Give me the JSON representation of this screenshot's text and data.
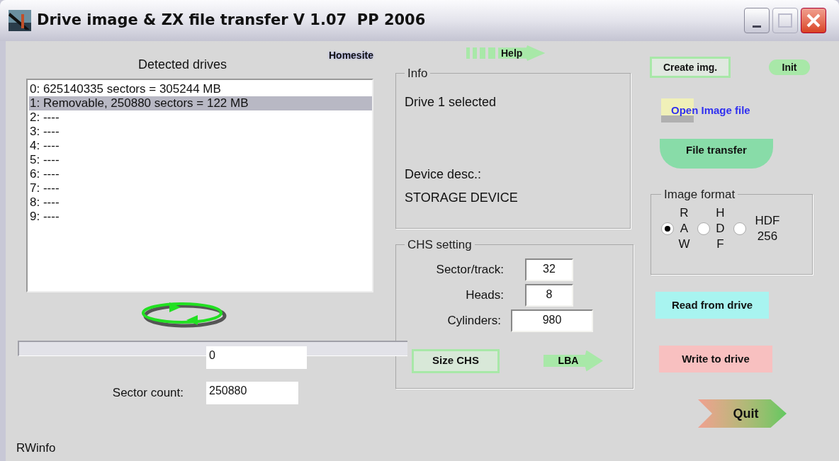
{
  "window": {
    "title": "Drive image & ZX file transfer V 1.07  PP 2006"
  },
  "homesite": "Homesite",
  "help": "Help",
  "drives": {
    "title": "Detected drives",
    "items": [
      {
        "label": "0: 625140335 sectors = 305244 MB",
        "selected": false
      },
      {
        "label": "1: Removable, 250880 sectors = 122 MB",
        "selected": true
      },
      {
        "label": "2: ----",
        "selected": false
      },
      {
        "label": "3: ----",
        "selected": false
      },
      {
        "label": "4: ----",
        "selected": false
      },
      {
        "label": "5: ----",
        "selected": false
      },
      {
        "label": "6: ----",
        "selected": false
      },
      {
        "label": "7: ----",
        "selected": false
      },
      {
        "label": "8: ----",
        "selected": false
      },
      {
        "label": "9: ----",
        "selected": false
      }
    ]
  },
  "progress": {
    "level": 0
  },
  "sectors_from_start": {
    "value": "0"
  },
  "sector_count": {
    "label": "Sector count:",
    "value": "250880"
  },
  "status": "RWinfo",
  "info": {
    "title": "Info",
    "message": "Drive 1 selected",
    "device_label": "Device desc.:",
    "device": "STORAGE DEVICE"
  },
  "chs": {
    "title": "CHS setting",
    "fields": [
      {
        "label": "Sector/track:",
        "value": "32"
      },
      {
        "label": "Heads:",
        "value": "8"
      },
      {
        "label": "Cylinders:",
        "value": "980"
      }
    ],
    "size_button": "Size CHS",
    "lba_button": "LBA"
  },
  "buttons": {
    "create": "Create img.",
    "init": "Init",
    "open": "Open Image file",
    "transfer": "File transfer",
    "read": "Read from drive",
    "write": "Write to drive",
    "quit": "Quit"
  },
  "image_format": {
    "title": "Image format",
    "options": [
      {
        "label": "RAW",
        "kind": "vertical",
        "selected": true
      },
      {
        "label": "HDF",
        "kind": "vertical",
        "selected": false
      },
      {
        "label": "HDF 256",
        "kind": "wrapped",
        "selected": false
      }
    ]
  }
}
